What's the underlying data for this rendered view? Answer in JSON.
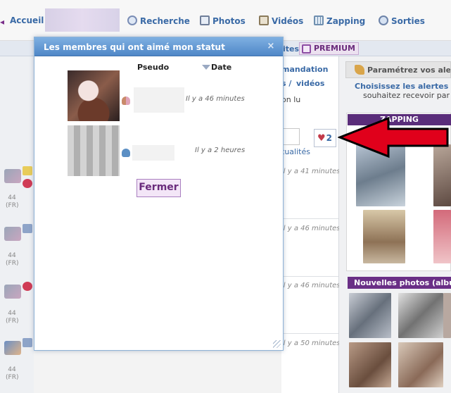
{
  "nav": {
    "home": "Accueil",
    "search": "Recherche",
    "photos": "Photos",
    "videos": "Vidéos",
    "zapping": "Zapping",
    "sorties": "Sorties"
  },
  "subbar": {
    "partial_link": "ites",
    "premium": "PREMIUM"
  },
  "background": {
    "recommandation": "mandation",
    "photos_videos_a": "s /",
    "photos_videos_b": "vidéos",
    "unread": "on lu",
    "actualites": "tualités",
    "like_count": "2",
    "times": [
      "il y a 41 minutes",
      "il y a 46 minutes",
      "il y a 46 minutes",
      "il y a 50 minutes"
    ],
    "left_codes": [
      "44",
      "(FR)"
    ]
  },
  "right": {
    "alerts_button": "Paramétrez vos alerte",
    "alerts_title": "Choisissez les alertes",
    "alerts_sub": "souhaitez recevoir par",
    "zapping_title": "ZAPPING",
    "new_photos_title": "Nouvelles photos (album"
  },
  "modal": {
    "title": "Les membres qui ont aimé mon statut",
    "close": "×",
    "col_pseudo": "Pseudo",
    "col_date": "Date",
    "members": [
      {
        "date": "Il y a 46 minutes"
      },
      {
        "date": "Il y a 2 heures"
      }
    ],
    "close_button": "Fermer"
  },
  "colors": {
    "accent_blue": "#3a6aa6",
    "title_bar": "#4f87c7",
    "purple": "#6a2b7c",
    "arrow_red": "#e0001b"
  },
  "icons": [
    "home-icon",
    "search-icon",
    "photos-icon",
    "videos-icon",
    "zapping-icon",
    "sorties-icon",
    "premium-icon",
    "heart-icon",
    "close-icon",
    "sort-down-icon",
    "resize-grip-icon",
    "red-arrow-icon"
  ]
}
